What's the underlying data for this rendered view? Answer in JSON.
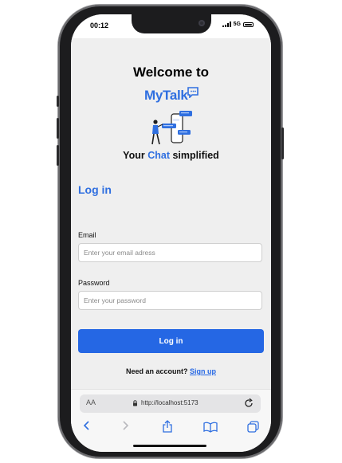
{
  "status": {
    "time": "00:12",
    "network": "5G"
  },
  "app": {
    "welcome": "Welcome to",
    "brand": "MyTalk",
    "tagline_prefix": "Your ",
    "tagline_accent": "Chat",
    "tagline_suffix": " simplified"
  },
  "login": {
    "title": "Log in",
    "email_label": "Email",
    "email_placeholder": "Enter your email adress",
    "password_label": "Password",
    "password_placeholder": "Enter your password",
    "submit": "Log in",
    "signup_prompt": "Need an account? ",
    "signup_link": "Sign up"
  },
  "browser": {
    "aa": "AA",
    "url": "http://localhost:5173"
  },
  "colors": {
    "accent": "#2f6fe0",
    "button": "#2567e4"
  }
}
